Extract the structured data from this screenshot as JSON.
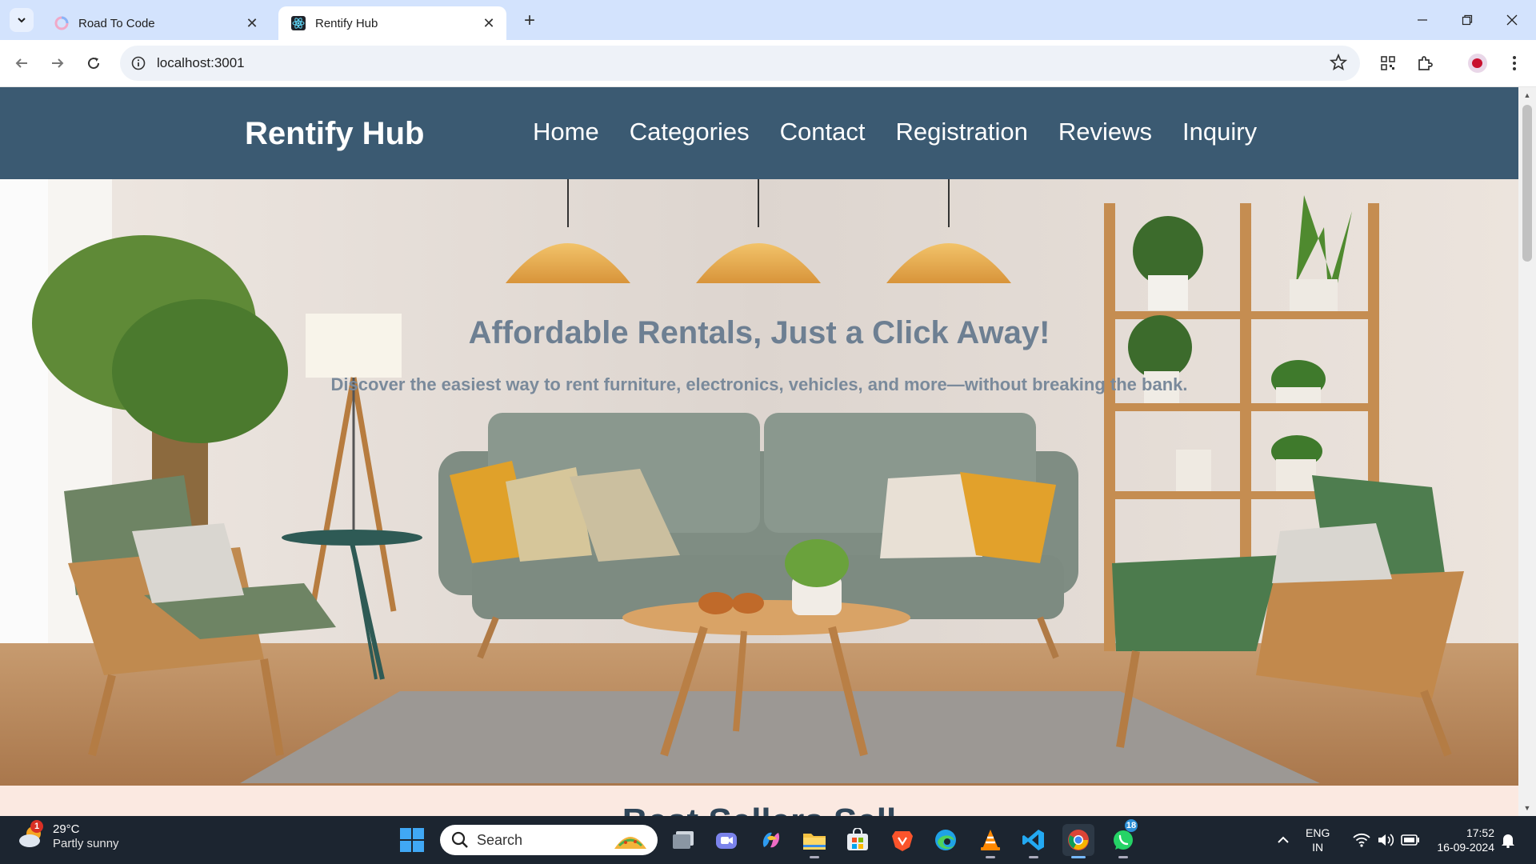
{
  "browser": {
    "tabs": [
      {
        "title": "Road To Code",
        "active": false
      },
      {
        "title": "Rentify Hub",
        "active": true
      }
    ],
    "url": "localhost:3001"
  },
  "site": {
    "brand": "Rentify Hub",
    "nav": [
      "Home",
      "Categories",
      "Contact",
      "Registration",
      "Reviews",
      "Inquiry"
    ],
    "hero": {
      "title": "Affordable Rentals, Just a Click Away!",
      "subtitle": "Discover the easiest way to rent furniture, electronics, vehicles, and more—without breaking the bank."
    },
    "next_section_peek": "Best Sellers Sell"
  },
  "taskbar": {
    "weather": {
      "temp": "29°C",
      "desc": "Partly sunny",
      "badge": "1"
    },
    "search_placeholder": "Search",
    "whatsapp_badge": "18",
    "language": [
      "ENG",
      "IN"
    ],
    "time": "17:52",
    "date": "16-09-2024"
  },
  "colors": {
    "nav_bg": "#3b5a72",
    "hero_title": "#6d7f92",
    "tabstrip": "#d3e3fd",
    "taskbar": "#1c2530"
  }
}
